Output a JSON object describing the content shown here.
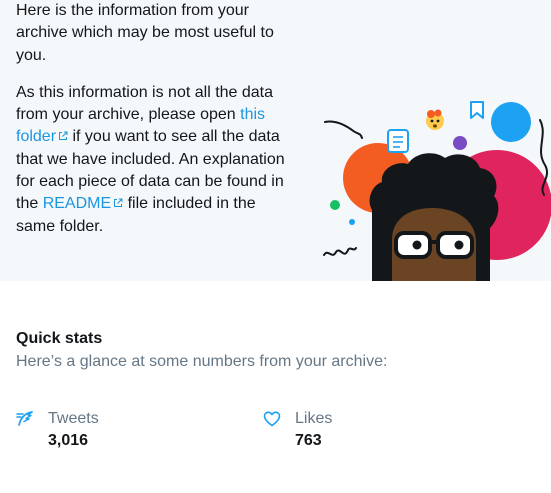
{
  "intro": {
    "paragraph1": "Here is the information from your archive which may be most useful to you.",
    "p2_part1": "As this information is not all the data from your archive, please open ",
    "folder_link": "this folder",
    "p2_part2": " if you want to see all the data that we have included. An explanation for each piece of data can be found in the ",
    "readme_link": "README",
    "p2_part3": " file included in the same folder."
  },
  "quick_stats": {
    "title": "Quick stats",
    "subtitle": "Here’s a glance at some numbers from your archive:",
    "tweets": {
      "label": "Tweets",
      "value": "3,016",
      "icon": "feather-icon"
    },
    "likes": {
      "label": "Likes",
      "value": "763",
      "icon": "heart-icon"
    }
  },
  "colors": {
    "link": "#1b95e0",
    "muted": "#657786",
    "panel_bg": "#f5f8fa"
  }
}
